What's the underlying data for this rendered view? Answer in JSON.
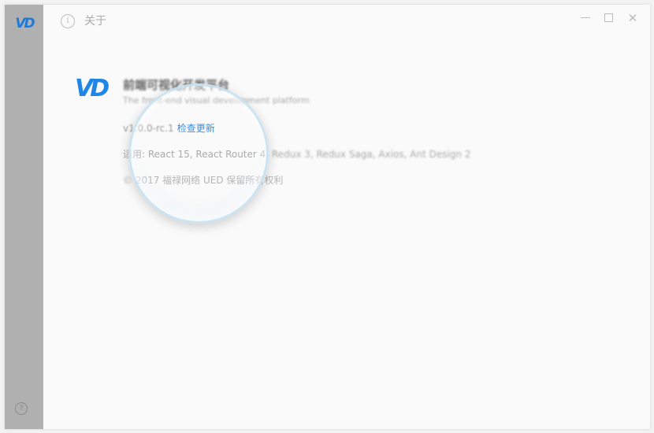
{
  "sidebar": {
    "logo_text": "VD",
    "help_icon": "help-circle-icon",
    "help_glyph": "?"
  },
  "titlebar": {
    "info_icon": "info-icon",
    "info_glyph": "i",
    "title": "关于",
    "minimize_glyph": "—",
    "maximize_icon": "maximize-icon",
    "close_glyph": "✕"
  },
  "about": {
    "logo_text": "VD",
    "app_name": "前端可视化开发平台",
    "app_description": "The front-end visual development platform",
    "version": "v1.0.0-rc.1",
    "check_update_label": "检查更新",
    "applies_prefix": "适用:",
    "applies_visible": " React 15, React Router 4,",
    "applies_blurred": " Redux 3, Redux Saga, Axios, Ant Design 2",
    "copyright_blurred_prefix": "© ",
    "copyright": "2017 福禄网络 UED 保留所有权利"
  },
  "colors": {
    "accent": "#1f86e6",
    "link": "#3a8ee6",
    "sidebar_bg": "#b0b0b0",
    "window_bg": "#fafafa"
  }
}
